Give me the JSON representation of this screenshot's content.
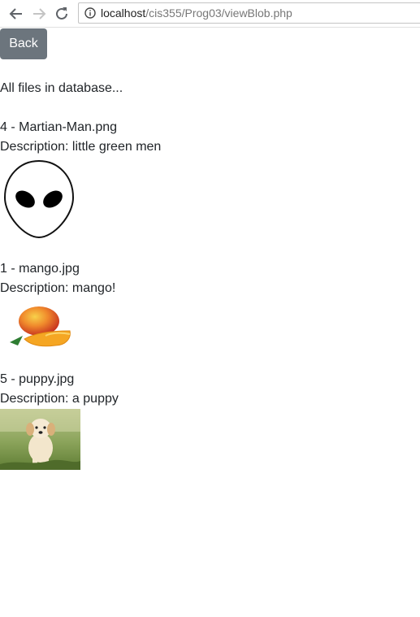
{
  "browser": {
    "url_host": "localhost",
    "url_path": "/cis355/Prog03/viewBlob.php"
  },
  "page": {
    "back_label": "Back",
    "heading": "All files in database..."
  },
  "files": [
    {
      "title": "4 - Martian-Man.png",
      "description": "Description: little green men",
      "image": "alien-face"
    },
    {
      "title": "1 - mango.jpg",
      "description": "Description: mango!",
      "image": "mango"
    },
    {
      "title": "5 - puppy.jpg",
      "description": "Description: a puppy",
      "image": "puppy-on-grass"
    }
  ]
}
